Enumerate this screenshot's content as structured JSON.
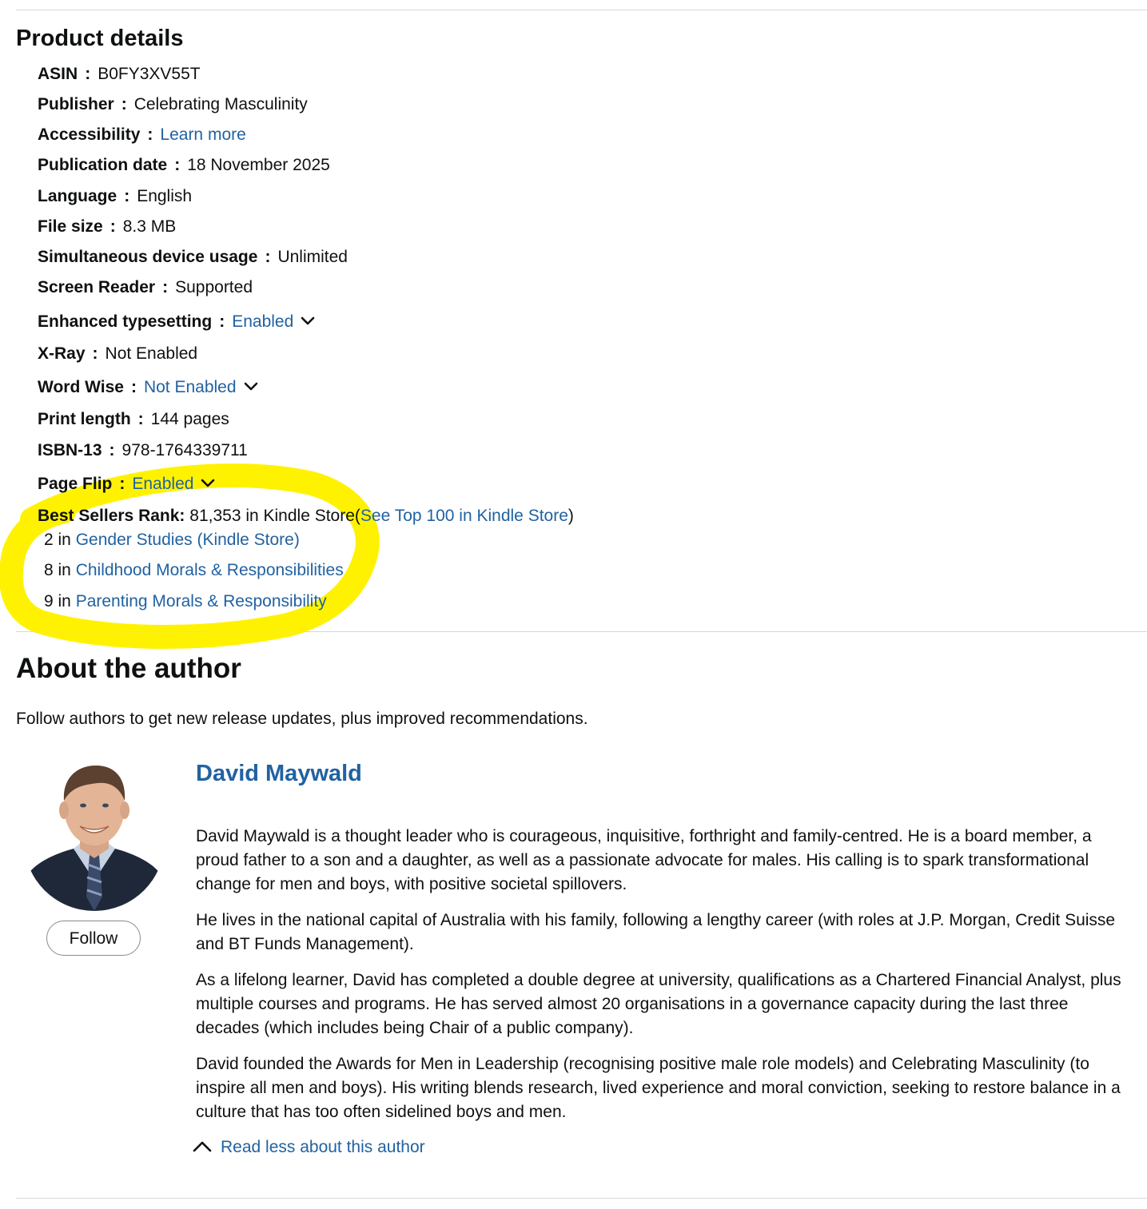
{
  "product_details": {
    "heading": "Product details",
    "rows": [
      {
        "key": "ASIN",
        "value": "B0FY3XV55T"
      },
      {
        "key": "Publisher",
        "value": "Celebrating Masculinity"
      },
      {
        "key": "Accessibility",
        "value": "Learn more"
      },
      {
        "key": "Publication date",
        "value": "18 November 2025"
      },
      {
        "key": "Language",
        "value": "English"
      },
      {
        "key": "File size",
        "value": "8.3 MB"
      },
      {
        "key": "Simultaneous device usage",
        "value": "Unlimited"
      },
      {
        "key": "Screen Reader",
        "value": "Supported"
      },
      {
        "key": "Enhanced typesetting",
        "value": "Enabled"
      },
      {
        "key": "X-Ray",
        "value": "Not Enabled"
      },
      {
        "key": "Word Wise",
        "value": "Not Enabled"
      },
      {
        "key": "Print length",
        "value": "144 pages"
      },
      {
        "key": "ISBN-13",
        "value": "978-1764339711"
      },
      {
        "key": "Page Flip",
        "value": "Enabled"
      }
    ],
    "separator": ":",
    "best_sellers": {
      "label": "Best Sellers Rank:",
      "main_rank": "81,353 in Kindle Store",
      "open_paren": "(",
      "see_top_link": "See Top 100 in Kindle Store",
      "close_paren": ")",
      "categories": [
        {
          "prefix": "2 in",
          "link": "Gender Studies (Kindle Store)"
        },
        {
          "prefix": "8 in",
          "link": "Childhood Morals & Responsibilities"
        },
        {
          "prefix": "9 in",
          "link": "Parenting Morals & Responsibility"
        }
      ]
    }
  },
  "about_author": {
    "heading": "About the author",
    "subtitle": "Follow authors to get new release updates, plus improved recommendations.",
    "follow_label": "Follow",
    "name": "David Maywald",
    "bio": [
      "David Maywald is a thought leader who is courageous, inquisitive, forthright and family-centred. He is a board member, a proud father to a son and a daughter, as well as a passionate advocate for males. His calling is to spark transformational change for men and boys, with positive societal spillovers.",
      "He lives in the national capital of Australia with his family, following a lengthy career (with roles at J.P. Morgan, Credit Suisse and BT Funds Management).",
      "As a lifelong learner, David has completed a double degree at university, qualifications as a Chartered Financial Analyst, plus multiple courses and programs. He has served almost 20 organisations in a governance capacity during the last three decades (which includes being Chair of a public company).",
      "David founded the Awards for Men in Leadership (recognising positive male role models) and Celebrating Masculinity (to inspire all men and boys). His writing blends research, lived experience and moral conviction, seeking to restore balance in a culture that has too often sidelined boys and men."
    ],
    "read_less_label": "Read less about this author"
  },
  "colors": {
    "link": "#2162a1",
    "text": "#0f1111",
    "highlight": "#fff200",
    "divider": "#d5d9d9"
  }
}
